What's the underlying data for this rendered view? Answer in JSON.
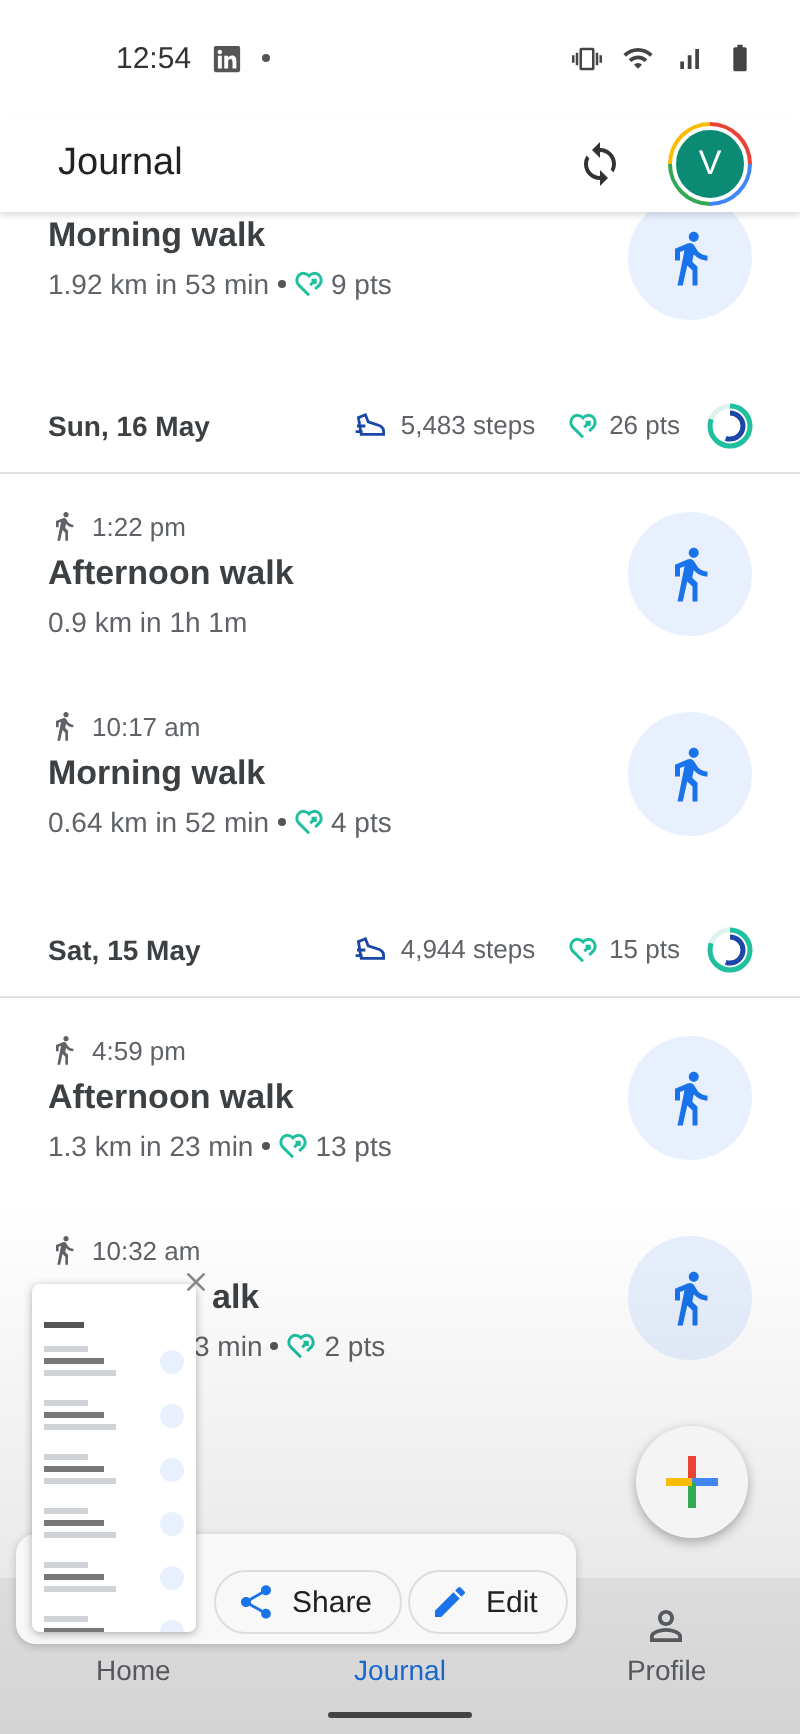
{
  "status_bar": {
    "time": "12:54"
  },
  "app_bar": {
    "title": "Journal",
    "avatar_letter": "V"
  },
  "sections": [
    {
      "activities": [
        {
          "kind": "scrolled",
          "title": "Morning walk",
          "distance": "1.92 km in 53 min",
          "points": "9 pts"
        }
      ]
    },
    {
      "header": {
        "date": "Sun, 16 May",
        "steps": "5,483 steps",
        "points": "26 pts"
      },
      "activities": [
        {
          "kind": "full",
          "time": "1:22 pm",
          "title": "Afternoon walk",
          "distance": "0.9 km in 1h 1m"
        },
        {
          "kind": "full",
          "time": "10:17 am",
          "title": "Morning walk",
          "distance": "0.64 km in 52 min",
          "points": "4 pts"
        }
      ]
    },
    {
      "header": {
        "date": "Sat, 15 May",
        "steps": "4,944 steps",
        "points": "15 pts"
      },
      "activities": [
        {
          "kind": "full",
          "time": "4:59 pm",
          "title": "Afternoon walk",
          "distance": "1.3 km in 23 min",
          "points": "13 pts"
        },
        {
          "kind": "covered",
          "time": "10:32 am",
          "title": "alk",
          "distance": "3 min",
          "points": "2 pts"
        }
      ]
    }
  ],
  "screenshot_actions": [
    {
      "kind": "share",
      "label": "Share"
    },
    {
      "kind": "edit",
      "label": "Edit"
    }
  ],
  "nav": [
    {
      "label": "Home",
      "selected": false,
      "kind": "home"
    },
    {
      "label": "Journal",
      "selected": true,
      "kind": "journal"
    },
    {
      "label": "Profile",
      "selected": false,
      "kind": "profile"
    }
  ]
}
